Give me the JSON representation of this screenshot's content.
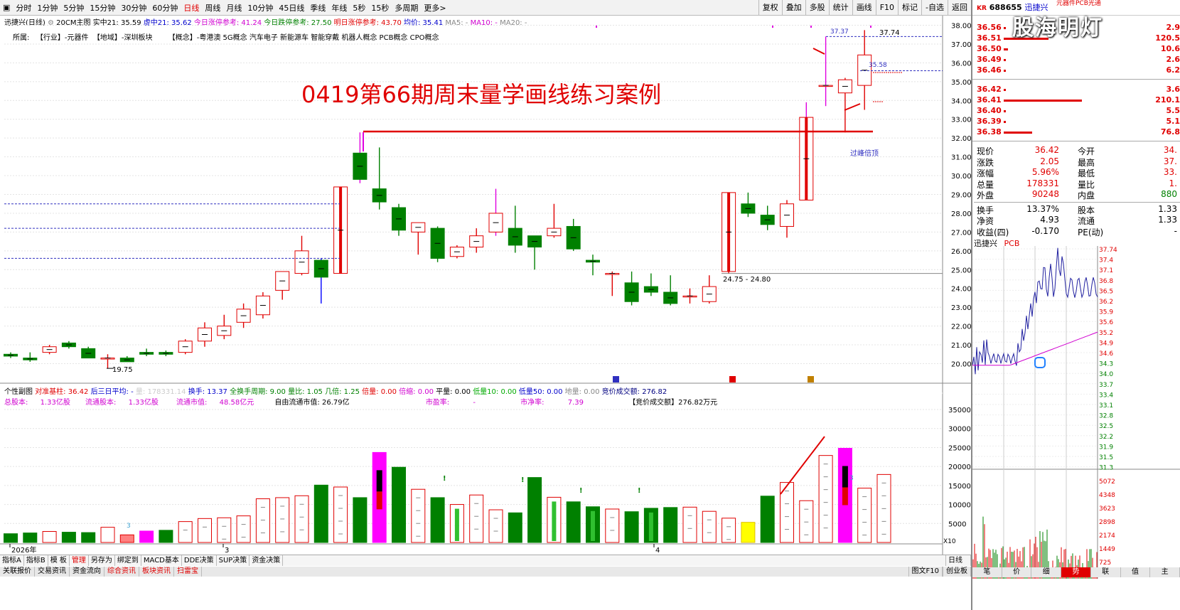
{
  "toolbar": {
    "periods": [
      "分时",
      "1分钟",
      "5分钟",
      "15分钟",
      "30分钟",
      "60分钟",
      "日线",
      "周线",
      "月线",
      "10分钟",
      "45日线",
      "季线",
      "年线",
      "5秒",
      "15秒",
      "多周期",
      "更多>"
    ],
    "active_period": "日线",
    "right_buttons": [
      "复权",
      "叠加",
      "多股",
      "统计",
      "画线",
      "F10",
      "标记",
      "-自选",
      "返回"
    ]
  },
  "info": {
    "stock": "迅捷兴(日线)",
    "main_chart": "20CM主图",
    "real": "实中21: 35.59",
    "virtual": "虚中21: 35.62",
    "limit_up_today": "今日涨停参考: 41.24",
    "limit_down_today": "今日跌停参考: 27.50",
    "limit_up_tomorrow": "明日涨停参考: 43.70",
    "avg": "均价: 35.41",
    "ma5": "MA5: -",
    "ma10": "MA10: -",
    "ma20": "MA20: -"
  },
  "category": {
    "label": "所属:",
    "industry": "【行业】-元器件",
    "region": "【地域】-深圳板块",
    "concepts": "【概念】-粤港澳 5G概念 汽车电子 新能源车 智能穿戴 机器人概念 PCB概念 CPO概念"
  },
  "annotation": {
    "title": "0419第66期周末量学画线练习案例",
    "peak_label": "过峰倍顶",
    "range_label": "24.75 - 24.80",
    "low_label": "19.75",
    "high_label": "37.74",
    "high2_label": "37.37",
    "mid_label": "35.58"
  },
  "chart_data": [
    {
      "type": "candlestick",
      "title": "迅捷兴(日线)",
      "yticks": [
        "38.00",
        "37.00",
        "36.00",
        "35.00",
        "34.00",
        "33.00",
        "32.00",
        "31.00",
        "30.00",
        "29.00",
        "28.00",
        "27.00",
        "26.00",
        "25.00",
        "24.00",
        "23.00",
        "22.00",
        "21.00",
        "20.00"
      ],
      "ylim": [
        19.4,
        38.2
      ],
      "candles": [
        {
          "o": 20.5,
          "h": 20.6,
          "l": 20.3,
          "c": 20.4
        },
        {
          "o": 20.3,
          "h": 20.6,
          "l": 20.1,
          "c": 20.2
        },
        {
          "o": 20.6,
          "h": 21.0,
          "l": 20.5,
          "c": 20.9
        },
        {
          "o": 21.1,
          "h": 21.2,
          "l": 20.8,
          "c": 20.9
        },
        {
          "o": 20.8,
          "h": 20.9,
          "l": 20.3,
          "c": 20.3
        },
        {
          "o": 20.3,
          "h": 20.5,
          "l": 19.75,
          "c": 20.3
        },
        {
          "o": 20.3,
          "h": 20.4,
          "l": 20.1,
          "c": 20.1
        },
        {
          "o": 20.6,
          "h": 20.8,
          "l": 20.4,
          "c": 20.5
        },
        {
          "o": 20.6,
          "h": 20.7,
          "l": 20.4,
          "c": 20.5
        },
        {
          "o": 20.6,
          "h": 21.3,
          "l": 20.5,
          "c": 21.2
        },
        {
          "o": 21.2,
          "h": 22.2,
          "l": 20.9,
          "c": 21.9
        },
        {
          "o": 21.5,
          "h": 22.6,
          "l": 21.3,
          "c": 22.0
        },
        {
          "o": 22.2,
          "h": 23.2,
          "l": 21.9,
          "c": 22.9
        },
        {
          "o": 22.6,
          "h": 23.8,
          "l": 22.4,
          "c": 23.6
        },
        {
          "o": 23.9,
          "h": 24.9,
          "l": 23.4,
          "c": 24.9
        },
        {
          "o": 24.8,
          "h": 26.8,
          "l": 24.7,
          "c": 26.0
        },
        {
          "o": 25.5,
          "h": 25.6,
          "l": 23.2,
          "c": 24.6
        },
        {
          "o": 24.8,
          "h": 29.4,
          "l": 24.8,
          "c": 29.4
        },
        {
          "o": 31.2,
          "h": 32.3,
          "l": 29.6,
          "c": 29.8
        },
        {
          "o": 29.3,
          "h": 31.5,
          "l": 28.2,
          "c": 28.6
        },
        {
          "o": 28.3,
          "h": 28.5,
          "l": 26.8,
          "c": 27.1
        },
        {
          "o": 27.0,
          "h": 27.4,
          "l": 25.8,
          "c": 27.5
        },
        {
          "o": 27.2,
          "h": 27.3,
          "l": 25.4,
          "c": 25.6
        },
        {
          "o": 25.7,
          "h": 26.3,
          "l": 25.6,
          "c": 26.2
        },
        {
          "o": 26.2,
          "h": 27.2,
          "l": 25.9,
          "c": 26.8
        },
        {
          "o": 27.0,
          "h": 29.3,
          "l": 26.8,
          "c": 28.0
        },
        {
          "o": 27.2,
          "h": 28.4,
          "l": 25.9,
          "c": 26.3
        },
        {
          "o": 26.8,
          "h": 26.8,
          "l": 25.0,
          "c": 26.2
        },
        {
          "o": 26.8,
          "h": 28.5,
          "l": 26.7,
          "c": 27.2
        },
        {
          "o": 27.3,
          "h": 27.7,
          "l": 26.0,
          "c": 26.1
        },
        {
          "o": 25.5,
          "h": 25.8,
          "l": 24.7,
          "c": 25.4
        },
        {
          "o": 24.8,
          "h": 24.9,
          "l": 23.6,
          "c": 24.8
        },
        {
          "o": 24.3,
          "h": 24.9,
          "l": 23.1,
          "c": 23.3
        },
        {
          "o": 24.1,
          "h": 24.8,
          "l": 23.6,
          "c": 23.8
        },
        {
          "o": 23.8,
          "h": 24.7,
          "l": 23.1,
          "c": 23.2
        },
        {
          "o": 23.6,
          "h": 24.0,
          "l": 23.2,
          "c": 23.6
        },
        {
          "o": 23.3,
          "h": 24.7,
          "l": 23.2,
          "c": 24.1
        },
        {
          "o": 24.9,
          "h": 29.1,
          "l": 24.8,
          "c": 29.1
        },
        {
          "o": 28.5,
          "h": 29.1,
          "l": 27.8,
          "c": 28.0
        },
        {
          "o": 27.9,
          "h": 28.4,
          "l": 27.1,
          "c": 27.4
        },
        {
          "o": 27.3,
          "h": 28.7,
          "l": 26.7,
          "c": 28.5
        },
        {
          "o": 28.7,
          "h": 33.9,
          "l": 28.7,
          "c": 33.1
        },
        {
          "o": 34.8,
          "h": 37.4,
          "l": 33.7,
          "c": 34.8
        },
        {
          "o": 34.4,
          "h": 35.2,
          "l": 32.3,
          "c": 35.1
        },
        {
          "o": 34.8,
          "h": 37.74,
          "l": 33.5,
          "c": 36.42
        }
      ]
    },
    {
      "type": "bar",
      "title": "个性副图",
      "yticks": [
        "35000",
        "30000",
        "25000",
        "20000",
        "15000",
        "10000",
        "5000"
      ],
      "ylim": [
        0,
        38000
      ],
      "values": [
        2300,
        2500,
        2900,
        2700,
        2600,
        4000,
        2000,
        3000,
        3200,
        5500,
        6300,
        6500,
        7000,
        11500,
        11800,
        12300,
        15100,
        14600,
        11800,
        23700,
        19800,
        14000,
        11800,
        10000,
        12500,
        8600,
        7800,
        17100,
        11900,
        10700,
        9400,
        8800,
        8100,
        9000,
        9200,
        9300,
        8200,
        6400,
        5300,
        12200,
        15800,
        11000,
        22900,
        24800,
        14300,
        17900
      ],
      "x_labels": [
        "2026年",
        "3",
        "4"
      ],
      "x_label_units": "X10"
    }
  ],
  "vol_head": {
    "name": "个性副图",
    "base": "对准基柱: 36.42",
    "avg3": "后三日平均: -",
    "qty": "量: 178331.14",
    "turnover": "换手: 13.37",
    "all_turn": "全换手周期: 9.00",
    "ratio": "量比: 1.05",
    "times": "几倍: 1.25",
    "double": "倍量: 0.00",
    "shrink": "倍缩: 0.00",
    "flat": "平量: 0.00",
    "low10": "低量10: 0.00",
    "low50": "低量50: 0.00",
    "ground": "地量: 0.00",
    "bid": "竞价成交额: 276.82"
  },
  "vol_head2": {
    "total_label": "总股本:",
    "total": "1.33亿股",
    "float_label": "流通股本:",
    "float": "1.33亿股",
    "mv_label": "流通市值:",
    "mv": "48.58亿元",
    "free_label": "自由流通市值:",
    "free": "26.79亿",
    "pe_label": "市盈率:",
    "pe": "-",
    "pb_label": "市净率:",
    "pb": "7.39",
    "bid_label": "【竞价成交额】276.82万元"
  },
  "bottom_tabs": [
    "指标A",
    "指标B",
    "模 板",
    "管理",
    "另存为",
    "绑定到",
    "MACD基本",
    "DDE决策",
    "SUP决策",
    "资金决策"
  ],
  "bottom_right": "日线",
  "status_tabs": [
    "关联报价",
    "交易资讯",
    "资金流向",
    "综合资讯",
    "板块资讯",
    "扫雷宝"
  ],
  "status_right": [
    "图文F10",
    "创业板"
  ],
  "right_panel": {
    "code": "688655",
    "name": "迅捷兴",
    "tag": "元器件PCB光通",
    "watermark": "股海明灯",
    "asks": [
      {
        "p": "36.56",
        "v": "2.9"
      },
      {
        "p": "36.51",
        "v": "120.5"
      },
      {
        "p": "36.50",
        "v": "10.6"
      },
      {
        "p": "36.49",
        "v": "2.6"
      },
      {
        "p": "36.46",
        "v": "6.2"
      }
    ],
    "bids": [
      {
        "p": "36.42",
        "v": "3.6"
      },
      {
        "p": "36.41",
        "v": "210.1"
      },
      {
        "p": "36.40",
        "v": "5.5"
      },
      {
        "p": "36.39",
        "v": "5.1"
      },
      {
        "p": "36.38",
        "v": "76.8"
      }
    ],
    "stats": [
      [
        "现价",
        "36.42",
        "今开",
        "34."
      ],
      [
        "涨跌",
        "2.05",
        "最高",
        "37."
      ],
      [
        "涨幅",
        "5.96%",
        "最低",
        "33."
      ],
      [
        "总量",
        "178331",
        "量比",
        "1."
      ],
      [
        "外盘",
        "90248",
        "内盘",
        "880"
      ]
    ],
    "stats2": [
      [
        "换手",
        "13.37%",
        "股本",
        "1.33"
      ],
      [
        "净资",
        "4.93",
        "流通",
        "1.33"
      ],
      [
        "收益(四)",
        "-0.170",
        "PE(动)",
        "-"
      ]
    ],
    "mini_name": "迅捷兴",
    "mini_tag": "PCB",
    "mini_yticks": [
      "37.74",
      "37.4",
      "37.1",
      "36.8",
      "36.5",
      "36.2",
      "35.9",
      "35.6",
      "35.2",
      "34.9",
      "34.6",
      "34.3",
      "34.0",
      "33.7",
      "33.4",
      "33.1",
      "32.8",
      "32.5",
      "32.2",
      "31.9",
      "31.5",
      "31.3"
    ],
    "vol_yticks": [
      "5072",
      "4348",
      "3623",
      "2898",
      "2174",
      "1449",
      "725"
    ],
    "bottom_tabs": [
      "笔",
      "价",
      "细",
      "势",
      "联",
      "值",
      "主"
    ]
  }
}
